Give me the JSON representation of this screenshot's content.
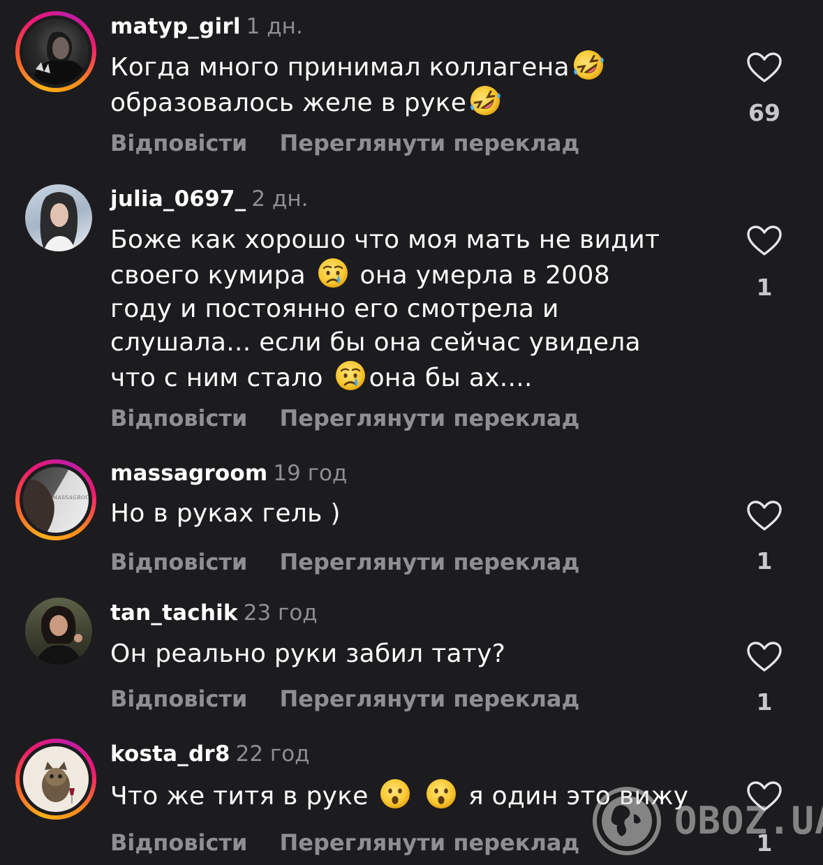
{
  "comments": [
    {
      "username": "matyp_girl",
      "time": "1 дн.",
      "lines": [
        "Когда много принимал коллагена",
        "образовалось желе в руке"
      ],
      "likes": "69",
      "reply_label": "Відповісти",
      "translate_label": "Переглянути переклад"
    },
    {
      "username": "julia_0697_",
      "time": "2 дн.",
      "lines": [
        "Боже как хорошо что моя мать не видит",
        "своего кумира",
        "она умерла в 2008",
        "году и постоянно его смотрела и",
        "слушала... если бы она сейчас увидела",
        "что с ним стало",
        "она бы ах...."
      ],
      "likes": "1",
      "reply_label": "Відповісти",
      "translate_label": "Переглянути переклад"
    },
    {
      "username": "massagroom",
      "time": "19 год",
      "lines": [
        "Но в руках гель )"
      ],
      "likes": "1",
      "reply_label": "Відповісти",
      "translate_label": "Переглянути переклад"
    },
    {
      "username": "tan_tachik",
      "time": "23 год",
      "lines": [
        "Он реально руки забил тату?"
      ],
      "likes": "1",
      "reply_label": "Відповісти",
      "translate_label": "Переглянути переклад"
    },
    {
      "username": "kosta_dr8",
      "time": "22 год",
      "lines": [
        "Что же титя в руке",
        "я один это вижу"
      ],
      "likes": "1",
      "reply_label": "Відповісти",
      "translate_label": "Переглянути переклад"
    }
  ],
  "watermark": {
    "text": "OBOZ.UA"
  },
  "avatar_labels": {
    "massagroom": "MASSAGROOM"
  },
  "colors": {
    "background": "#1c1c1f",
    "secondary_text": "#8e8e93",
    "story_ring": [
      "#f9b11a",
      "#ee1a6f",
      "#c01ca8"
    ]
  },
  "icons": {
    "like": "heart-outline-icon",
    "laugh": "rolling-on-floor-laughing-emoji",
    "cry": "crying-face-emoji",
    "surprised": "hushed-face-emoji",
    "watermark": "globe-icon"
  }
}
